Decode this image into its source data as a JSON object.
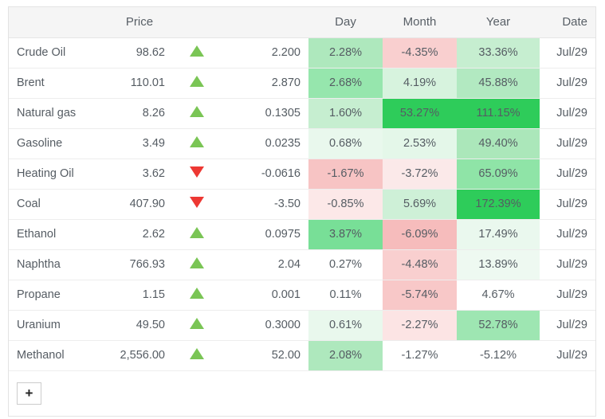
{
  "table": {
    "headers": {
      "name": "",
      "price": "Price",
      "arrow": "",
      "change": "",
      "day": "Day",
      "month": "Month",
      "year": "Year",
      "date": "Date"
    },
    "rows": [
      {
        "name": "Crude Oil",
        "price": "98.62",
        "direction": "up",
        "change": "2.200",
        "day": "2.28%",
        "month": "-4.35%",
        "year": "33.36%",
        "date": "Jul/29",
        "day_bg": "#aee8bd",
        "month_bg": "#f9cfcf",
        "year_bg": "#c6eed0"
      },
      {
        "name": "Brent",
        "price": "110.01",
        "direction": "up",
        "change": "2.870",
        "day": "2.68%",
        "month": "4.19%",
        "year": "45.88%",
        "date": "Jul/29",
        "day_bg": "#96e6ad",
        "month_bg": "#d7f3de",
        "year_bg": "#b2e9c1"
      },
      {
        "name": "Natural gas",
        "price": "8.26",
        "direction": "up",
        "change": "0.1305",
        "day": "1.60%",
        "month": "53.27%",
        "year": "111.15%",
        "date": "Jul/29",
        "day_bg": "#c6eed0",
        "month_bg": "#2ecc5a",
        "year_bg": "#2ecc5a"
      },
      {
        "name": "Gasoline",
        "price": "3.49",
        "direction": "up",
        "change": "0.0235",
        "day": "0.68%",
        "month": "2.53%",
        "year": "49.40%",
        "date": "Jul/29",
        "day_bg": "#e9f8ed",
        "month_bg": "#e4f7e9",
        "year_bg": "#abe7ba"
      },
      {
        "name": "Heating Oil",
        "price": "3.62",
        "direction": "down",
        "change": "-0.0616",
        "day": "-1.67%",
        "month": "-3.72%",
        "year": "65.09%",
        "date": "Jul/29",
        "day_bg": "#f7c4c4",
        "month_bg": "#fbe9e9",
        "year_bg": "#8fe4a7"
      },
      {
        "name": "Coal",
        "price": "407.90",
        "direction": "down",
        "change": "-3.50",
        "day": "-0.85%",
        "month": "5.69%",
        "year": "172.39%",
        "date": "Jul/29",
        "day_bg": "#fce8e8",
        "month_bg": "#cef0d7",
        "year_bg": "#2ecc5a"
      },
      {
        "name": "Ethanol",
        "price": "2.62",
        "direction": "up",
        "change": "0.0975",
        "day": "3.87%",
        "month": "-6.09%",
        "year": "17.49%",
        "date": "Jul/29",
        "day_bg": "#78df97",
        "month_bg": "#f6bcbc",
        "year_bg": "#eaf8ee"
      },
      {
        "name": "Naphtha",
        "price": "766.93",
        "direction": "up",
        "change": "2.04",
        "day": "0.27%",
        "month": "-4.48%",
        "year": "13.89%",
        "date": "Jul/29",
        "day_bg": "#ffffff",
        "month_bg": "#f9cfcf",
        "year_bg": "#eef9f1"
      },
      {
        "name": "Propane",
        "price": "1.15",
        "direction": "up",
        "change": "0.001",
        "day": "0.11%",
        "month": "-5.74%",
        "year": "4.67%",
        "date": "Jul/29",
        "day_bg": "#ffffff",
        "month_bg": "#f8c8c8",
        "year_bg": "#ffffff"
      },
      {
        "name": "Uranium",
        "price": "49.50",
        "direction": "up",
        "change": "0.3000",
        "day": "0.61%",
        "month": "-2.27%",
        "year": "52.78%",
        "date": "Jul/29",
        "day_bg": "#e9f8ed",
        "month_bg": "#fce4e4",
        "year_bg": "#9ee6b2"
      },
      {
        "name": "Methanol",
        "price": "2,556.00",
        "direction": "up",
        "change": "52.00",
        "day": "2.08%",
        "month": "-1.27%",
        "year": "-5.12%",
        "date": "Jul/29",
        "day_bg": "#aee8bd",
        "month_bg": "#ffffff",
        "year_bg": "#ffffff"
      }
    ],
    "add_button_label": "+"
  },
  "colors": {
    "up_arrow": "#7ac555",
    "down_arrow": "#ed3833",
    "header_bg": "#f5f5f5",
    "text": "#555c63",
    "border": "#ededed"
  }
}
